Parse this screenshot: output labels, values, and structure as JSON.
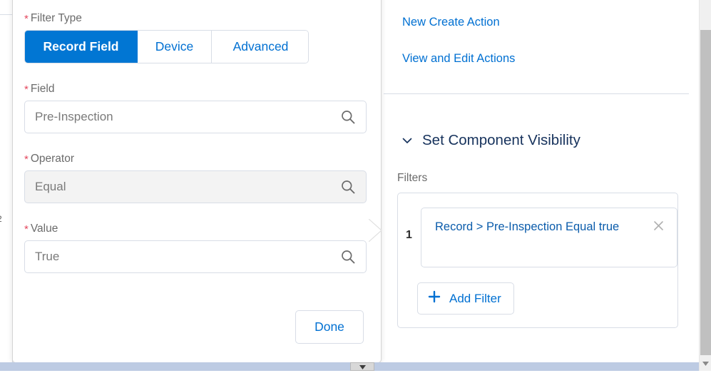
{
  "colors": {
    "accent_blue": "#0176d3",
    "link_blue": "#0070d2",
    "navy": "#16325c",
    "required_red": "#e4485e",
    "border_grey": "#d8dde6",
    "disabled_bg": "#f3f3f3"
  },
  "left_sliver": {
    "clipped_text": "2"
  },
  "properties_pane": {
    "links": [
      {
        "label": "New Create Action",
        "name": "new-create-action"
      },
      {
        "label": "View and Edit Actions",
        "name": "view-and-edit-actions"
      }
    ],
    "visibility_section": {
      "title": "Set Component Visibility",
      "expanded": true,
      "chevron_icon": "chevron-down-icon"
    },
    "filters": {
      "label": "Filters",
      "rows": [
        {
          "index": "1",
          "text": "Record > Pre-Inspection Equal true",
          "remove_icon": "close-icon"
        }
      ],
      "add_button": {
        "label": "Add Filter",
        "icon": "plus-icon"
      }
    }
  },
  "popover": {
    "filter_type": {
      "label": "Filter Type",
      "required": true,
      "options": [
        "Record Field",
        "Device",
        "Advanced"
      ],
      "selected": "Record Field"
    },
    "fields": [
      {
        "label": "Field",
        "required": true,
        "value": "Pre-Inspection",
        "disabled": false,
        "icon": "search-icon",
        "name": "field-lookup"
      },
      {
        "label": "Operator",
        "required": true,
        "value": "Equal",
        "disabled": true,
        "icon": "search-icon",
        "name": "operator-lookup"
      },
      {
        "label": "Value",
        "required": true,
        "value": "True",
        "disabled": false,
        "icon": "search-icon",
        "name": "value-lookup"
      }
    ],
    "done_label": "Done"
  },
  "scrollbars": {
    "vertical_down_icon": "triangle-down-icon",
    "horizontal_thumb_icon": "triangle-down-icon"
  }
}
